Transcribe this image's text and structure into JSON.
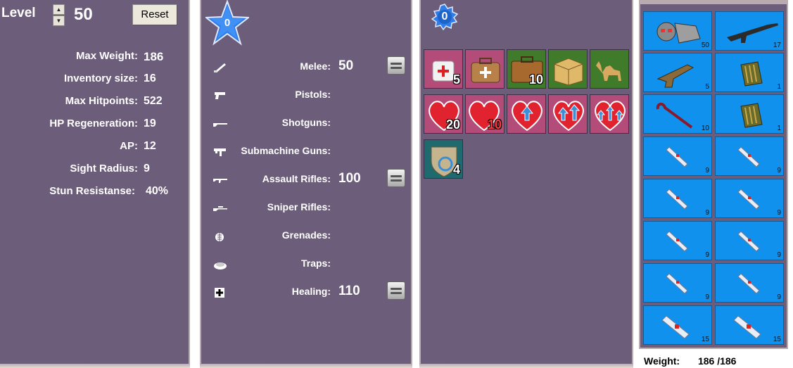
{
  "stats": {
    "level_label": "Level",
    "level_value": "50",
    "reset_label": "Reset",
    "items": [
      {
        "label": "Max Weight:",
        "value": "186"
      },
      {
        "label": "Inventory size:",
        "value": "16"
      },
      {
        "label": "Max Hitpoints:",
        "value": "522"
      },
      {
        "label": "HP Regeneration:",
        "value": "19"
      },
      {
        "label": "AP:",
        "value": "12"
      },
      {
        "label": "Sight Radius:",
        "value": "9"
      },
      {
        "label": "Stun Resistanse:",
        "value": "40%"
      }
    ]
  },
  "skills": {
    "points": "0",
    "items": [
      {
        "label": "Melee:",
        "value": "50",
        "icon": "knife-icon"
      },
      {
        "label": "Pistols:",
        "value": "",
        "icon": "pistol-icon"
      },
      {
        "label": "Shotguns:",
        "value": "",
        "icon": "shotgun-icon"
      },
      {
        "label": "Submachine Guns:",
        "value": "",
        "icon": "smg-icon"
      },
      {
        "label": "Assault Rifles:",
        "value": "100",
        "icon": "rifle-icon"
      },
      {
        "label": "Sniper Rifles:",
        "value": "",
        "icon": "sniper-icon"
      },
      {
        "label": "Grenades:",
        "value": "",
        "icon": "grenade-icon"
      },
      {
        "label": "Traps:",
        "value": "",
        "icon": "trap-icon"
      },
      {
        "label": "Healing:",
        "value": "110",
        "icon": "medkit-icon"
      }
    ]
  },
  "perks": {
    "points": "0",
    "row1": [
      {
        "name": "medical-bag",
        "count": "5"
      },
      {
        "name": "doctor-case",
        "count": ""
      },
      {
        "name": "suitcase",
        "count": "10"
      },
      {
        "name": "cardboard-box",
        "count": ""
      },
      {
        "name": "camel",
        "count": ""
      }
    ],
    "row2": [
      {
        "name": "heart",
        "count": "20"
      },
      {
        "name": "heart-minus",
        "count": "10"
      },
      {
        "name": "heart-arrow-1",
        "count": ""
      },
      {
        "name": "heart-arrow-2",
        "count": ""
      },
      {
        "name": "heart-arrow-3",
        "count": ""
      }
    ],
    "row3": [
      {
        "name": "shield-swirl",
        "count": "4"
      }
    ]
  },
  "inventory": {
    "items": [
      {
        "name": "power-armor",
        "qty": "50"
      },
      {
        "name": "assault-rifle",
        "qty": "17"
      },
      {
        "name": "heavy-pistol",
        "qty": "5"
      },
      {
        "name": "ammo-belt",
        "qty": "1"
      },
      {
        "name": "crowbar",
        "qty": "10"
      },
      {
        "name": "ammo-belt",
        "qty": "1"
      },
      {
        "name": "stimpak",
        "qty": "9"
      },
      {
        "name": "stimpak",
        "qty": "9"
      },
      {
        "name": "stimpak",
        "qty": "9"
      },
      {
        "name": "stimpak",
        "qty": "9"
      },
      {
        "name": "stimpak",
        "qty": "9"
      },
      {
        "name": "stimpak",
        "qty": "9"
      },
      {
        "name": "stimpak",
        "qty": "9"
      },
      {
        "name": "stimpak",
        "qty": "9"
      },
      {
        "name": "big-stimpak",
        "qty": "15"
      },
      {
        "name": "big-stimpak",
        "qty": "15"
      }
    ],
    "weight_label": "Weight:",
    "weight_value": "186 /186"
  },
  "colors": {
    "panel": "#6c5d7a",
    "slot": "#1191ee",
    "star": "#2f7de8"
  }
}
